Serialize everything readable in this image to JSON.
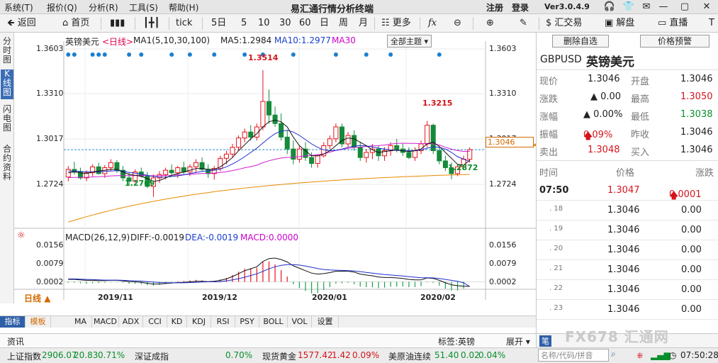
{
  "menu": [
    "系统(T)",
    "报价(Q)",
    "分析(R)",
    "工具(S)",
    "帮助(H)"
  ],
  "app_title": "易汇通行情分析终端",
  "register": "注册",
  "login": "登录",
  "version": "Ver3.0.4.9",
  "toolbar": {
    "back": "返回",
    "home": "首页",
    "tick": "tick",
    "d5": "5日",
    "m5": "5",
    "m10": "10",
    "m30": "30",
    "m60": "60",
    "day": "日",
    "week": "周",
    "month": "月",
    "more": "更多",
    "fx": "fx",
    "trade": "汇交易",
    "jiepan": "解盘",
    "live": "直播",
    "tw": "T"
  },
  "vtabs": [
    "分时图",
    "K线图",
    "闪电图",
    "合约资料"
  ],
  "chart": {
    "pair_name": "英镑美元",
    "period_label": "<日线>",
    "ma_header": "MA1(5,10,30,100)",
    "ma5": "MA5:1.2984",
    "ma10": "MA10:1.2977",
    "ma30": "MA30",
    "theme_btn": "全部主题",
    "y_ticks": [
      "1.3603",
      "1.3310",
      "1.3017",
      "1.2724"
    ],
    "last_price": "1.3046",
    "high_label": "1.3514",
    "high2_label": "1.3215",
    "low_label": "1.2769",
    "low2_label": "1.2872",
    "macd_header": "MACD(26,12,9)",
    "diff": "DIFF:-0.0019",
    "dea": "DEA:-0.0019",
    "macd": "MACD:0.0000",
    "macd_ticks": [
      "0.0156",
      "0.0079",
      "0.0002"
    ],
    "dates": [
      "2019/11",
      "2019/12",
      "2020/01",
      "2020/02"
    ],
    "period_tab": "日线"
  },
  "chart_data": {
    "type": "candlestick",
    "y_range": [
      1.26,
      1.366
    ],
    "candles": [
      [
        1.2885,
        1.295,
        1.286,
        1.293
      ],
      [
        1.293,
        1.2975,
        1.29,
        1.2915
      ],
      [
        1.2915,
        1.294,
        1.287,
        1.288
      ],
      [
        1.288,
        1.2925,
        1.286,
        1.291
      ],
      [
        1.291,
        1.296,
        1.289,
        1.2945
      ],
      [
        1.2945,
        1.297,
        1.29,
        1.2905
      ],
      [
        1.2905,
        1.2955,
        1.288,
        1.294
      ],
      [
        1.294,
        1.299,
        1.292,
        1.297
      ],
      [
        1.297,
        1.2985,
        1.291,
        1.2925
      ],
      [
        1.2925,
        1.295,
        1.286,
        1.288
      ],
      [
        1.288,
        1.291,
        1.284,
        1.286
      ],
      [
        1.286,
        1.293,
        1.285,
        1.2915
      ],
      [
        1.2915,
        1.294,
        1.288,
        1.289
      ],
      [
        1.289,
        1.2915,
        1.282,
        1.283
      ],
      [
        1.283,
        1.29,
        1.2769,
        1.288
      ],
      [
        1.288,
        1.292,
        1.285,
        1.29
      ],
      [
        1.29,
        1.294,
        1.287,
        1.2925
      ],
      [
        1.2925,
        1.296,
        1.289,
        1.291
      ],
      [
        1.291,
        1.295,
        1.288,
        1.294
      ],
      [
        1.294,
        1.2975,
        1.29,
        1.2915
      ],
      [
        1.2915,
        1.296,
        1.289,
        1.2945
      ],
      [
        1.2945,
        1.299,
        1.291,
        1.297
      ],
      [
        1.297,
        1.3,
        1.292,
        1.293
      ],
      [
        1.293,
        1.296,
        1.288,
        1.2905
      ],
      [
        1.2905,
        1.295,
        1.287,
        1.2935
      ],
      [
        1.2935,
        1.301,
        1.292,
        1.2995
      ],
      [
        1.2995,
        1.304,
        1.296,
        1.302
      ],
      [
        1.302,
        1.308,
        1.3,
        1.306
      ],
      [
        1.306,
        1.313,
        1.304,
        1.3115
      ],
      [
        1.3115,
        1.317,
        1.309,
        1.315
      ],
      [
        1.315,
        1.319,
        1.31,
        1.312
      ],
      [
        1.312,
        1.32,
        1.31,
        1.318
      ],
      [
        1.318,
        1.3514,
        1.316,
        1.333
      ],
      [
        1.333,
        1.34,
        1.32,
        1.325
      ],
      [
        1.325,
        1.33,
        1.318,
        1.32
      ],
      [
        1.32,
        1.326,
        1.31,
        1.312
      ],
      [
        1.312,
        1.316,
        1.302,
        1.305
      ],
      [
        1.305,
        1.31,
        1.296,
        1.299
      ],
      [
        1.299,
        1.307,
        1.297,
        1.305
      ],
      [
        1.305,
        1.309,
        1.298,
        1.3
      ],
      [
        1.3,
        1.303,
        1.294,
        1.2965
      ],
      [
        1.2965,
        1.302,
        1.294,
        1.301
      ],
      [
        1.301,
        1.309,
        1.3,
        1.307
      ],
      [
        1.307,
        1.313,
        1.305,
        1.311
      ],
      [
        1.311,
        1.32,
        1.309,
        1.318
      ],
      [
        1.318,
        1.32,
        1.306,
        1.308
      ],
      [
        1.308,
        1.315,
        1.306,
        1.313
      ],
      [
        1.313,
        1.316,
        1.304,
        1.306
      ],
      [
        1.306,
        1.309,
        1.298,
        1.3
      ],
      [
        1.3,
        1.305,
        1.297,
        1.303
      ],
      [
        1.303,
        1.308,
        1.299,
        1.305
      ],
      [
        1.305,
        1.307,
        1.298,
        1.301
      ],
      [
        1.301,
        1.306,
        1.298,
        1.304
      ],
      [
        1.304,
        1.309,
        1.301,
        1.307
      ],
      [
        1.307,
        1.311,
        1.303,
        1.305
      ],
      [
        1.305,
        1.308,
        1.301,
        1.303
      ],
      [
        1.303,
        1.306,
        1.299,
        1.3
      ],
      [
        1.3,
        1.306,
        1.298,
        1.304
      ],
      [
        1.304,
        1.31,
        1.302,
        1.308
      ],
      [
        1.308,
        1.3215,
        1.306,
        1.319
      ],
      [
        1.319,
        1.32,
        1.302,
        1.304
      ],
      [
        1.304,
        1.306,
        1.296,
        1.298
      ],
      [
        1.298,
        1.301,
        1.292,
        1.294
      ],
      [
        1.294,
        1.297,
        1.2872,
        1.2905
      ],
      [
        1.2905,
        1.296,
        1.289,
        1.2945
      ],
      [
        1.2945,
        1.301,
        1.293,
        1.299
      ],
      [
        1.299,
        1.306,
        1.297,
        1.3046
      ]
    ],
    "ma5": [
      1.291,
      1.2915,
      1.291,
      1.2905,
      1.2915,
      1.292,
      1.2925,
      1.293,
      1.293,
      1.2915,
      1.29,
      1.2895,
      1.289,
      1.2875,
      1.286,
      1.2865,
      1.288,
      1.2895,
      1.2905,
      1.2915,
      1.2925,
      1.2935,
      1.2935,
      1.293,
      1.293,
      1.2945,
      1.297,
      1.3,
      1.304,
      1.3075,
      1.311,
      1.314,
      1.318,
      1.321,
      1.322,
      1.321,
      1.318,
      1.312,
      1.307,
      1.304,
      1.301,
      1.301,
      1.302,
      1.304,
      1.307,
      1.31,
      1.3115,
      1.311,
      1.309,
      1.307,
      1.3045,
      1.303,
      1.3035,
      1.304,
      1.3045,
      1.304,
      1.3035,
      1.304,
      1.305,
      1.308,
      1.309,
      1.3065,
      1.303,
      1.2995,
      1.296,
      1.2955,
      1.2984
    ],
    "ma10": [
      1.292,
      1.292,
      1.2918,
      1.2915,
      1.2915,
      1.2915,
      1.2918,
      1.292,
      1.2922,
      1.292,
      1.2912,
      1.2908,
      1.2902,
      1.2895,
      1.2888,
      1.2885,
      1.2885,
      1.2888,
      1.2892,
      1.2898,
      1.2905,
      1.2912,
      1.2918,
      1.2922,
      1.2925,
      1.2932,
      1.2945,
      1.2962,
      1.2982,
      1.3005,
      1.303,
      1.3055,
      1.3085,
      1.3115,
      1.314,
      1.3155,
      1.316,
      1.315,
      1.313,
      1.3105,
      1.308,
      1.306,
      1.3045,
      1.304,
      1.3042,
      1.305,
      1.306,
      1.3068,
      1.307,
      1.3068,
      1.3062,
      1.3055,
      1.305,
      1.3045,
      1.3042,
      1.304,
      1.304,
      1.304,
      1.3045,
      1.3055,
      1.3062,
      1.306,
      1.305,
      1.303,
      1.3005,
      1.299,
      1.2977
    ],
    "ma30_start": 1.288,
    "ma100_start": 1.262,
    "macd_diff": [
      0.001,
      0.001,
      0.0008,
      0.0006,
      0.0006,
      0.0005,
      0.0005,
      0.0006,
      0.0006,
      0.0004,
      0.0001,
      0.0,
      -0.0002,
      -0.0006,
      -0.0009,
      -0.0009,
      -0.0007,
      -0.0005,
      -0.0003,
      -0.0002,
      0.0,
      0.0002,
      0.0002,
      0.0001,
      0.0002,
      0.0006,
      0.0012,
      0.0022,
      0.0034,
      0.0046,
      0.0054,
      0.0062,
      0.0084,
      0.0096,
      0.0098,
      0.0092,
      0.0082,
      0.0066,
      0.0056,
      0.0046,
      0.0036,
      0.0032,
      0.0034,
      0.0038,
      0.0044,
      0.0044,
      0.0044,
      0.004,
      0.0032,
      0.0028,
      0.0025,
      0.002,
      0.0018,
      0.0018,
      0.0016,
      0.0014,
      0.001,
      0.0008,
      0.0008,
      0.0016,
      0.0014,
      0.0006,
      -0.0004,
      -0.0012,
      -0.0016,
      -0.0018,
      -0.0019
    ],
    "macd_dea": [
      0.0012,
      0.0012,
      0.0011,
      0.001,
      0.0009,
      0.0008,
      0.0007,
      0.0007,
      0.0007,
      0.0006,
      0.0005,
      0.0004,
      0.0003,
      0.0001,
      -0.0001,
      -0.0003,
      -0.0004,
      -0.0004,
      -0.0004,
      -0.0004,
      -0.0003,
      -0.0002,
      -0.0001,
      0.0,
      0.0,
      0.0001,
      0.0004,
      0.0008,
      0.0013,
      0.0019,
      0.0026,
      0.0033,
      0.0043,
      0.0054,
      0.0062,
      0.0068,
      0.0071,
      0.0071,
      0.0069,
      0.0065,
      0.006,
      0.0055,
      0.0051,
      0.0049,
      0.0048,
      0.0047,
      0.0046,
      0.0045,
      0.0042,
      0.0039,
      0.0036,
      0.0033,
      0.003,
      0.0028,
      0.0026,
      0.0024,
      0.0021,
      0.0019,
      0.0017,
      0.0017,
      0.0016,
      0.0014,
      0.001,
      0.0006,
      0.0002,
      -0.0004,
      -0.0019
    ],
    "macd_range": [
      -0.006,
      0.018
    ]
  },
  "bottom_tabs": [
    "指标",
    "模板",
    "MA",
    "MACD",
    "ADX",
    "CCI",
    "KD",
    "KDJ",
    "RSI",
    "PSY",
    "BOLL",
    "VOL",
    "设置"
  ],
  "zixun": {
    "label": "资讯",
    "tag": "标签:英镑",
    "expand": "展开"
  },
  "status": {
    "idx_name": "上证指数",
    "idx_val": "2906.07",
    "idx_chg": "20.83",
    "idx_pct": "0.71%",
    "sz_name": "深证成指",
    "sz_pct": "0.70%",
    "gold_name": "现货黄金",
    "gold_val": "1577.42",
    "gold_chg": "1.42",
    "gold_pct": "0.09%",
    "oil_name": "美原油连续",
    "oil_val": "51.40",
    "oil_chg": "0.02",
    "oil_pct": "0.04%",
    "time": "07:50:28"
  },
  "right": {
    "del_btn": "删除自选",
    "alert_btn": "价格预警",
    "code": "GBPUSD",
    "name": "英镑美元",
    "quote": [
      {
        "l1": "现价",
        "v1": "1.3046",
        "l2": "开盘",
        "v2": "1.3046"
      },
      {
        "l1": "涨跌",
        "v1": "▲ 0.00",
        "l2": "最高",
        "v2": "1.3050"
      },
      {
        "l1": "涨幅",
        "v1": "▲ 0.00%",
        "l2": "最低",
        "v2": "1.3038"
      },
      {
        "l1": "振幅",
        "v1": "0.09%",
        "l2": "昨收",
        "v2": "1.3046"
      },
      {
        "l1": "卖出",
        "v1": "1.3048",
        "l2": "买入",
        "v2": "1.3046"
      }
    ],
    "tick_header": {
      "time": "时间",
      "price": "价格",
      "chg": "涨跌"
    },
    "ticks": [
      {
        "t": "07:50",
        "p": "1.3047",
        "c": "0.0001"
      },
      {
        "t": ". 18",
        "p": "1.3046",
        "c": "0.00"
      },
      {
        "t": ". 19",
        "p": "1.3046",
        "c": "0.00"
      },
      {
        "t": ". 20",
        "p": "1.3046",
        "c": "0.00"
      },
      {
        "t": ". 21",
        "p": "1.3046",
        "c": "0.00"
      },
      {
        "t": ". 22",
        "p": "1.3046",
        "c": "0.00"
      },
      {
        "t": ". 23",
        "p": "1.3046",
        "c": "0.00"
      }
    ],
    "search_placeholder": "名称/代码/拼音",
    "logo_text": "FX678 汇通网",
    "corner": "笔"
  }
}
